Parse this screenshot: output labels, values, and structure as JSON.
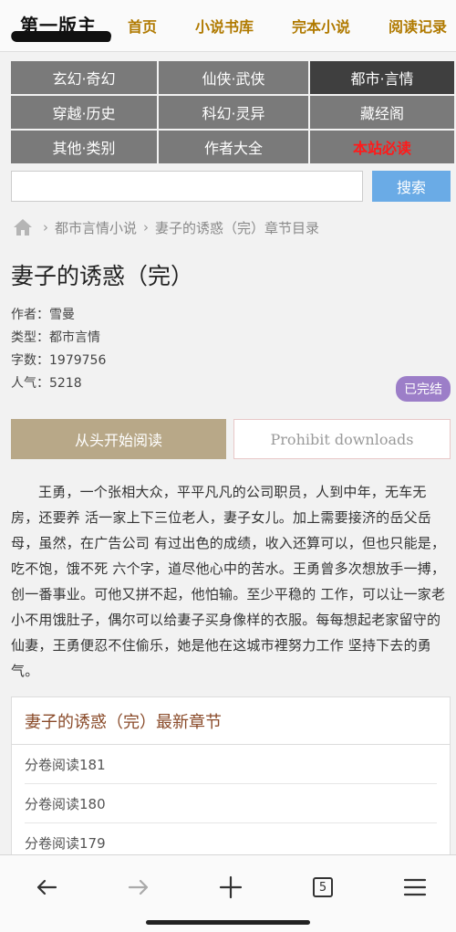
{
  "header": {
    "logo_text": "第一版主",
    "nav": [
      "首页",
      "小说书库",
      "完本小说",
      "阅读记录"
    ]
  },
  "categories": [
    "玄幻·奇幻",
    "仙侠·武侠",
    "都市·言情",
    "穿越·历史",
    "科幻·灵异",
    "藏经阁",
    "其他·类别",
    "作者大全",
    "本站必读"
  ],
  "search": {
    "placeholder": "",
    "button": "搜索"
  },
  "breadcrumb": {
    "category": "都市言情小说",
    "current": "妻子的诱惑（完）章节目录"
  },
  "book": {
    "title": "妻子的诱惑（完）",
    "author": "作者：雪曼",
    "type": "类型：都市言情",
    "word_count": "字数：1979756",
    "popularity": "人气：5218",
    "status": "已完结"
  },
  "actions": {
    "read_from_start": "从头开始阅读",
    "download": "Prohibit downloads"
  },
  "intro": "王勇，一个张相大众，平平凡凡的公司职员，人到中年，无车无房，还要养 活一家上下三位老人，妻子女儿。加上需要接济的岳父岳母，虽然，在广告公司 有过出色的成绩，收入还算可以，但也只能是，吃不饱，饿不死 六个字，道尽他心中的苦水。王勇曾多次想放手一搏，创一番事业。可他又拼不起，他怕输。至少平稳的 工作，可以让一家老小不用饿肚子，偶尔可以给妻子买身像样的衣服。每每想起老家留守的仙妻，王勇便忍不住偷乐，她是他在这城市裡努力工作 坚持下去的勇气。",
  "latest": {
    "heading": "妻子的诱惑（完）最新章节",
    "chapters": [
      "分卷阅读181",
      "分卷阅读180",
      "分卷阅读179"
    ]
  },
  "browser": {
    "tab_count": "5"
  }
}
